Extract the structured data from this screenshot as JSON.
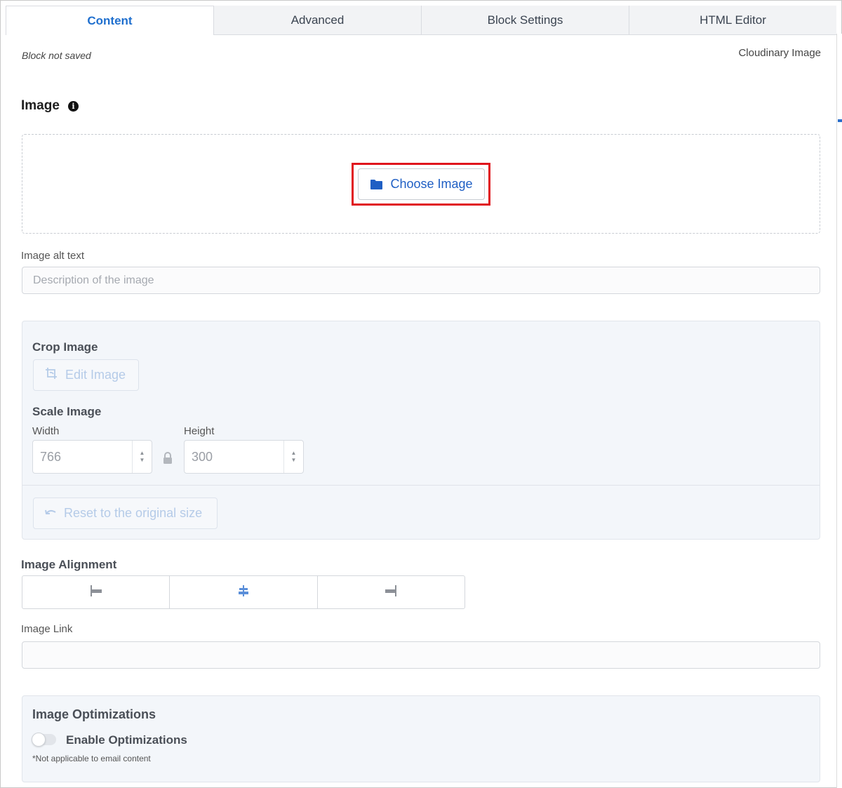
{
  "tabs": [
    {
      "label": "Content",
      "active": true
    },
    {
      "label": "Advanced",
      "active": false
    },
    {
      "label": "Block Settings",
      "active": false
    },
    {
      "label": "HTML Editor",
      "active": false
    }
  ],
  "status": {
    "save_state": "Block not saved",
    "block_type": "Cloudinary Image"
  },
  "image_section": {
    "title": "Image",
    "info_icon": "info-circle-icon",
    "choose_button": {
      "label": "Choose Image",
      "icon": "folder-icon"
    }
  },
  "alt_text": {
    "label": "Image alt text",
    "placeholder": "Description of the image",
    "value": ""
  },
  "crop": {
    "title": "Crop Image",
    "edit_button": {
      "label": "Edit Image",
      "icon": "crop-icon"
    }
  },
  "scale": {
    "title": "Scale Image",
    "width_label": "Width",
    "width_value": "766",
    "height_label": "Height",
    "height_value": "300",
    "lock_icon": "lock-icon",
    "reset_button": {
      "label": "Reset to the original size",
      "icon": "undo-icon"
    }
  },
  "alignment": {
    "title": "Image Alignment",
    "options": [
      "align-left-icon",
      "align-center-icon",
      "align-right-icon"
    ],
    "selected": "align-center-icon"
  },
  "link": {
    "label": "Image Link",
    "value": ""
  },
  "optimizations": {
    "title": "Image Optimizations",
    "toggle_label": "Enable Optimizations",
    "enabled": false,
    "note": "*Not applicable to email content"
  },
  "colors": {
    "accent": "#1f6fce",
    "highlight": "#e0141c",
    "panel_bg": "#f3f6fa"
  }
}
